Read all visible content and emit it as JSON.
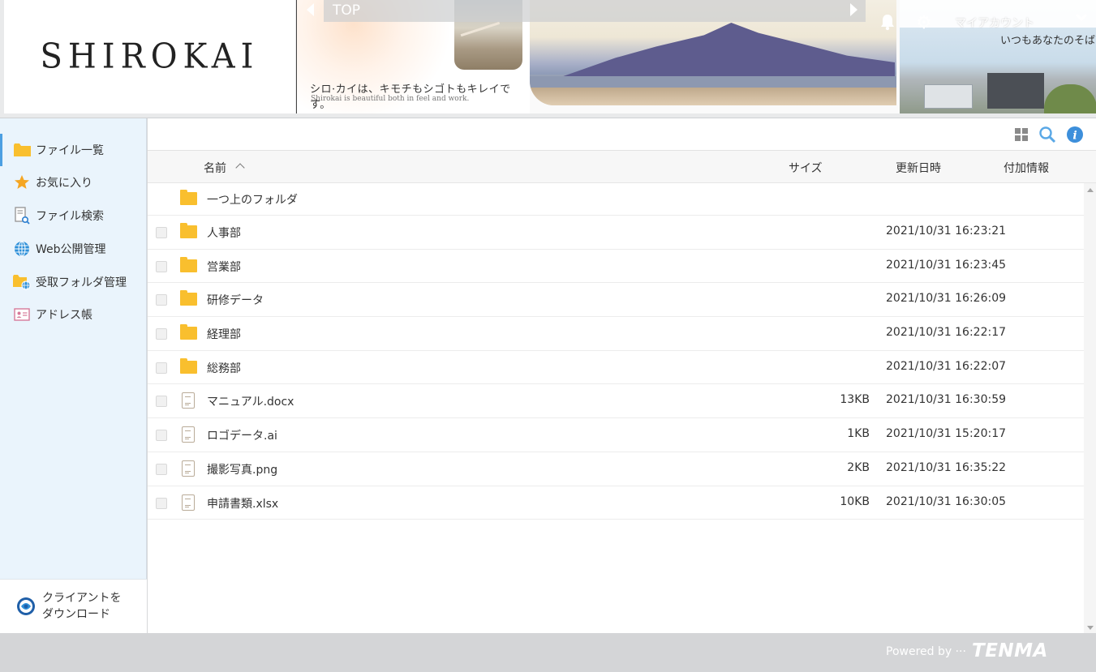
{
  "header": {
    "logo": "SHIROKAI",
    "banner_catch": "シロ·カイは、キモチもシゴトもキレイです。",
    "banner_catch_en": "Shirokai is beautiful both in feel and work.",
    "nav_label": "TOP",
    "account_label": "マイアカウント",
    "account_tagline": "いつもあなたのそば"
  },
  "sidebar": {
    "items": [
      {
        "label": "ファイル一覧",
        "icon": "folder-icon",
        "active": true
      },
      {
        "label": "お気に入り",
        "icon": "star-icon"
      },
      {
        "label": "ファイル検索",
        "icon": "file-search-icon"
      },
      {
        "label": "Web公開管理",
        "icon": "globe-icon"
      },
      {
        "label": "受取フォルダ管理",
        "icon": "folder-globe-icon"
      },
      {
        "label": "アドレス帳",
        "icon": "address-card-icon"
      }
    ],
    "download_line1": "クライアントを",
    "download_line2": "ダウンロード"
  },
  "toolbar": {
    "icons": [
      "grid-view-icon",
      "search-icon",
      "info-icon"
    ]
  },
  "list": {
    "columns": {
      "name": "名前",
      "size": "サイズ",
      "date": "更新日時",
      "info": "付加情報"
    },
    "parent_folder": "一つ上のフォルダ",
    "rows": [
      {
        "name": "人事部",
        "type": "folder",
        "size": "",
        "date": "2021/10/31 16:23:21"
      },
      {
        "name": "営業部",
        "type": "folder",
        "size": "",
        "date": "2021/10/31 16:23:45"
      },
      {
        "name": "研修データ",
        "type": "folder",
        "size": "",
        "date": "2021/10/31 16:26:09"
      },
      {
        "name": "経理部",
        "type": "folder",
        "size": "",
        "date": "2021/10/31 16:22:17"
      },
      {
        "name": "総務部",
        "type": "folder",
        "size": "",
        "date": "2021/10/31 16:22:07"
      },
      {
        "name": "マニュアル.docx",
        "type": "file",
        "size": "13KB",
        "date": "2021/10/31 16:30:59"
      },
      {
        "name": "ロゴデータ.ai",
        "type": "file",
        "size": "1KB",
        "date": "2021/10/31 15:20:17"
      },
      {
        "name": "撮影写真.png",
        "type": "file",
        "size": "2KB",
        "date": "2021/10/31 16:35:22"
      },
      {
        "name": "申請書類.xlsx",
        "type": "file",
        "size": "10KB",
        "date": "2021/10/31 16:30:05"
      }
    ]
  },
  "footer": {
    "powered_by": "Powered by ···",
    "brand": "TENMA"
  },
  "colors": {
    "accent": "#4c9fe2",
    "folder": "#f9bf2e",
    "sidebar_bg": "#eaf4fc"
  }
}
